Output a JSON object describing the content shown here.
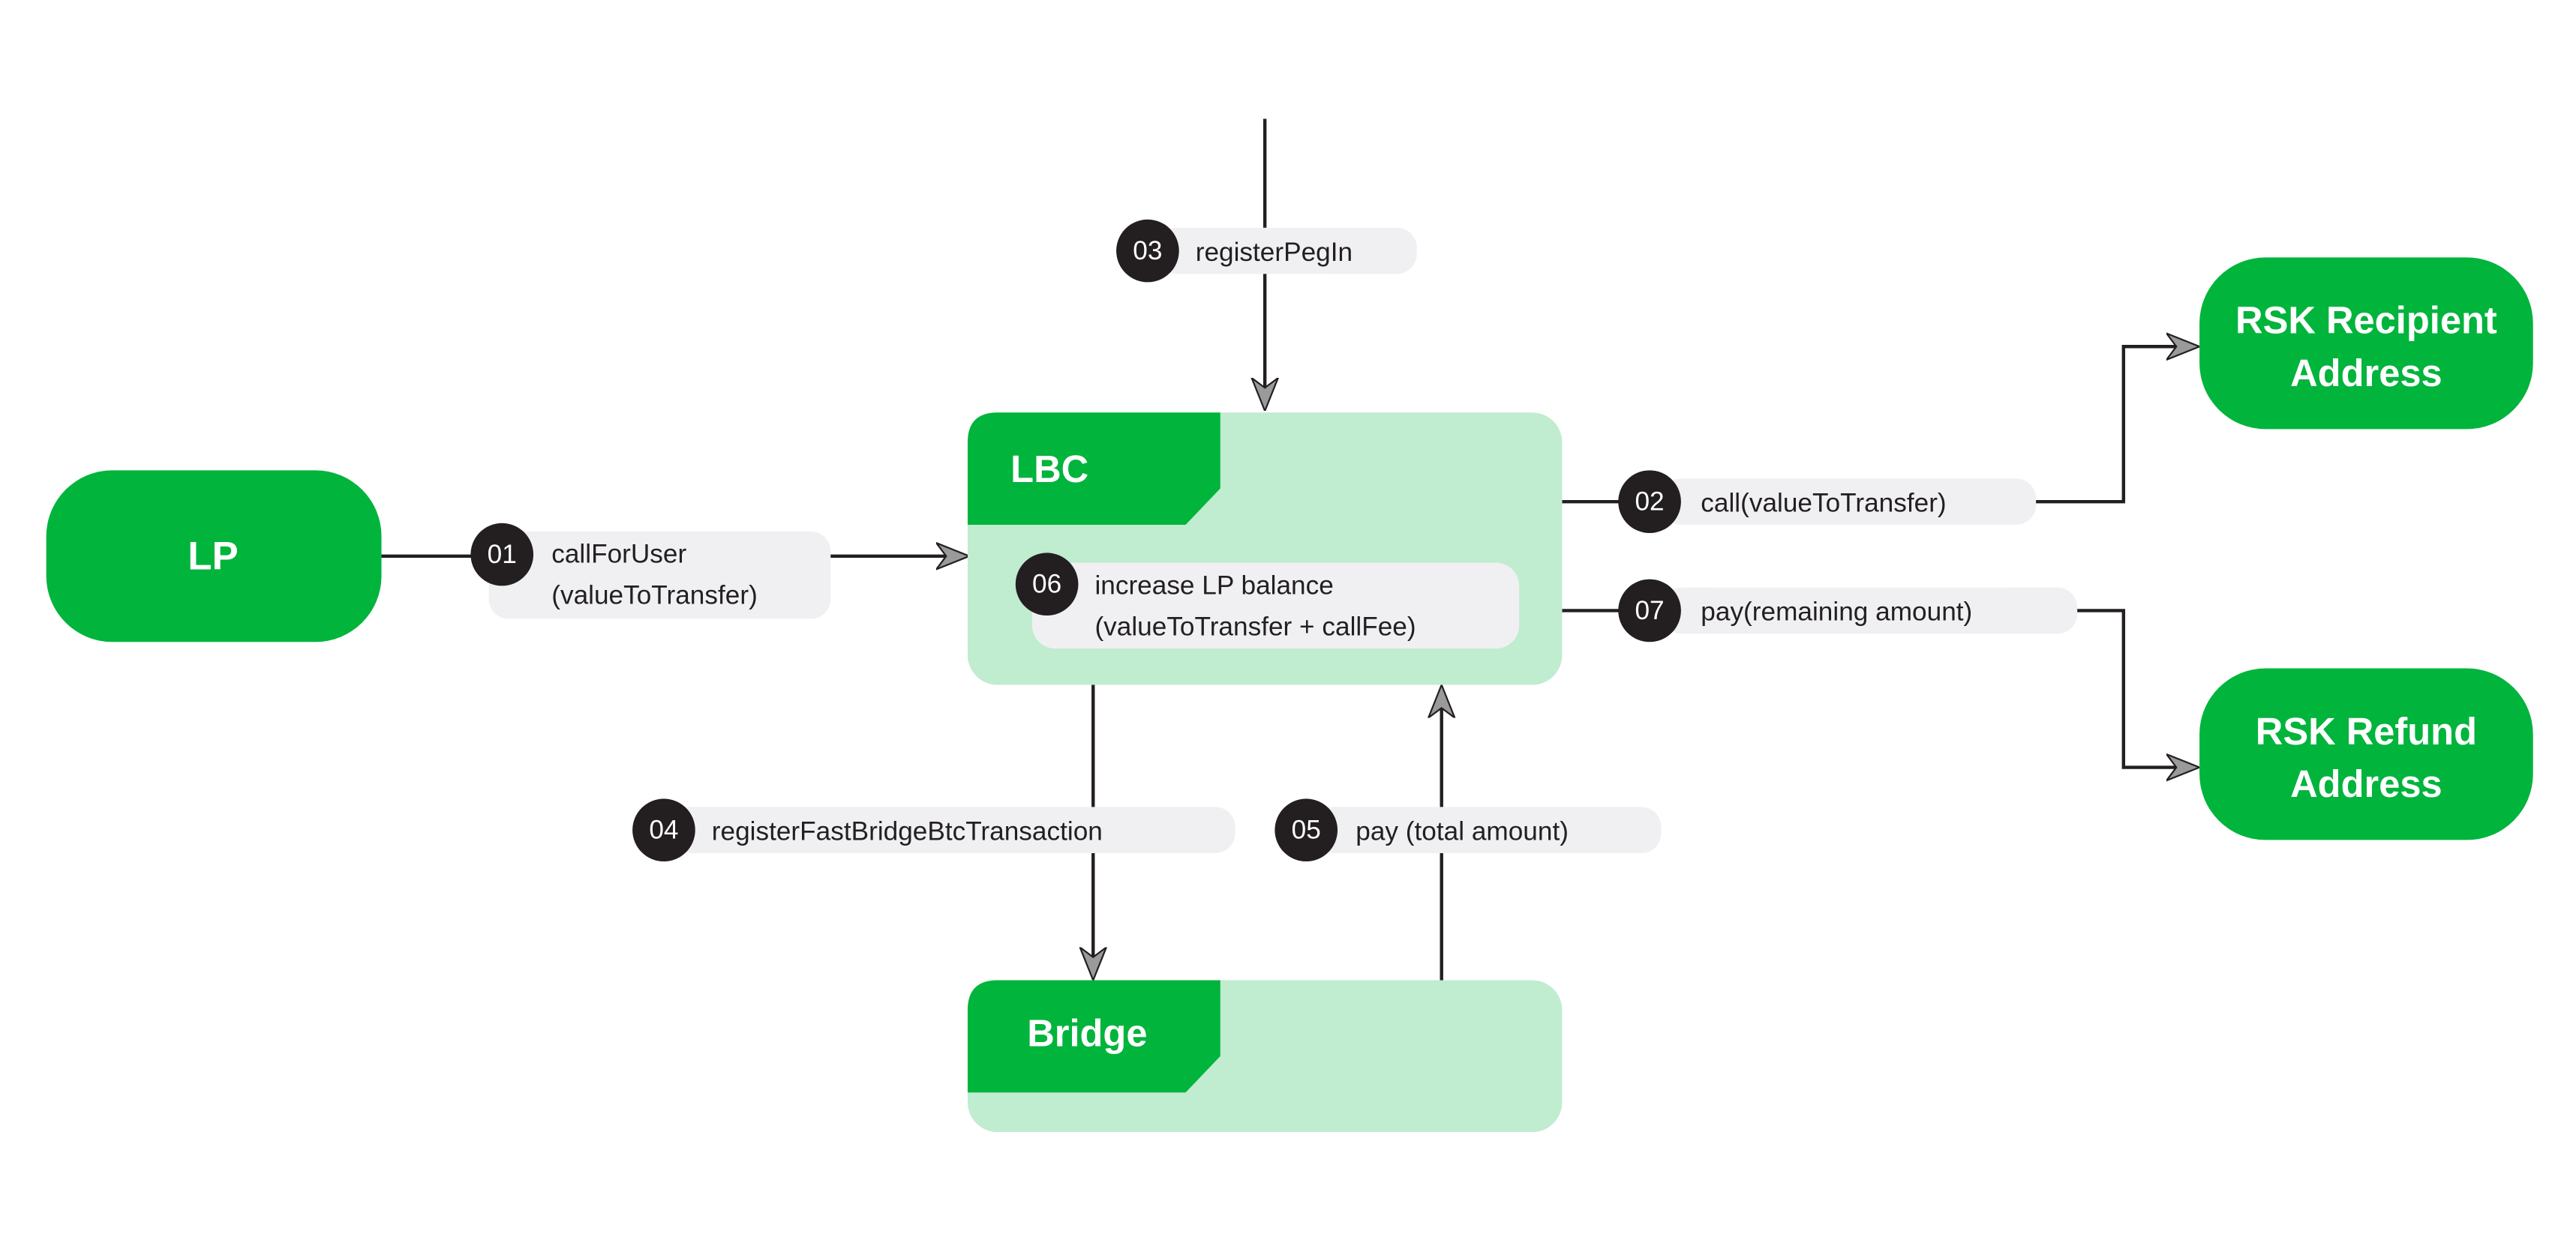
{
  "colors": {
    "node_green": "#00B43C",
    "container_light_green": "#C0ECD0",
    "badge_dark": "#231F20",
    "label_pill": "#F0F0F2",
    "arrow_head": "#9A9A9A"
  },
  "nodes": {
    "lp": "LP",
    "lbc": "LBC",
    "bridge": "Bridge",
    "rsk_recipient": [
      "RSK Recipient",
      "Address"
    ],
    "rsk_refund": [
      "RSK Refund",
      "Address"
    ]
  },
  "steps": [
    {
      "num": "01",
      "lines": [
        "callForUser",
        "(valueToTransfer)"
      ]
    },
    {
      "num": "02",
      "lines": [
        "call(valueToTransfer)"
      ]
    },
    {
      "num": "03",
      "lines": [
        "registerPegIn"
      ]
    },
    {
      "num": "04",
      "lines": [
        "registerFastBridgeBtcTransaction"
      ]
    },
    {
      "num": "05",
      "lines": [
        "pay (total amount)"
      ]
    },
    {
      "num": "06",
      "lines": [
        "increase LP balance",
        "(valueToTransfer + callFee)"
      ]
    },
    {
      "num": "07",
      "lines": [
        "pay(remaining amount)"
      ]
    }
  ]
}
